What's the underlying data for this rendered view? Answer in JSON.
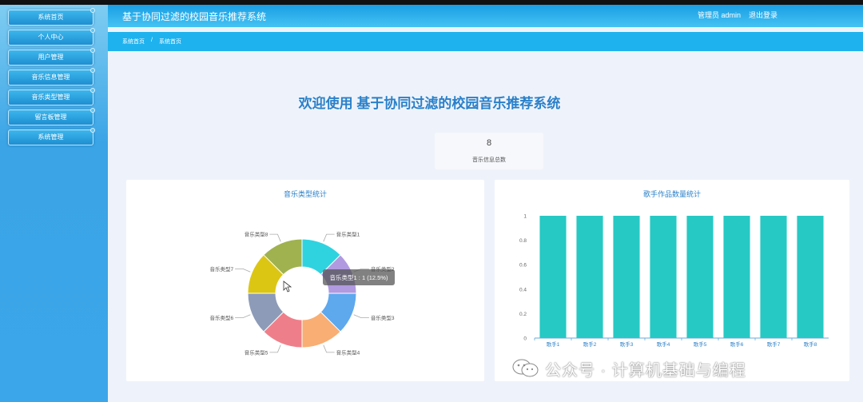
{
  "app": {
    "title": "基于协同过滤的校园音乐推荐系统"
  },
  "header": {
    "user_label": "管理员 admin",
    "logout_label": "退出登录"
  },
  "sidebar": {
    "items": [
      {
        "label": "系统首页"
      },
      {
        "label": "个人中心"
      },
      {
        "label": "用户管理"
      },
      {
        "label": "音乐信息管理"
      },
      {
        "label": "音乐类型管理"
      },
      {
        "label": "留言板管理"
      },
      {
        "label": "系统管理"
      }
    ]
  },
  "breadcrumb": {
    "items": [
      "系统首页",
      "系统首页"
    ],
    "separator": "/"
  },
  "welcome": {
    "text": "欢迎使用 基于协同过滤的校园音乐推荐系统"
  },
  "stat": {
    "value": "8",
    "label": "音乐信息总数"
  },
  "pie_chart": {
    "tooltip": "音乐类型1 : 1 (12.5%)"
  },
  "chart_data": [
    {
      "type": "pie",
      "title": "音乐类型统计",
      "categories": [
        "音乐类型1",
        "音乐类型2",
        "音乐类型3",
        "音乐类型4",
        "音乐类型5",
        "音乐类型6",
        "音乐类型7",
        "音乐类型8"
      ],
      "values": [
        1,
        1,
        1,
        1,
        1,
        1,
        1,
        1
      ],
      "colors": [
        "#2fd3e0",
        "#b19ae0",
        "#5ea8ee",
        "#f9ae73",
        "#ee7f8a",
        "#8d9bb8",
        "#dcc614",
        "#9fb24f"
      ],
      "donut": true
    },
    {
      "type": "bar",
      "title": "歌手作品数量统计",
      "categories": [
        "歌手1",
        "歌手2",
        "歌手3",
        "歌手4",
        "歌手5",
        "歌手6",
        "歌手7",
        "歌手8"
      ],
      "values": [
        1,
        1,
        1,
        1,
        1,
        1,
        1,
        1
      ],
      "yticks": [
        "0",
        "0.2",
        "0.4",
        "0.6",
        "0.8",
        "1"
      ],
      "ylim": [
        0,
        1
      ],
      "color": "#26c9c4",
      "grid": false
    }
  ],
  "watermark": {
    "text": "公众号 · 计算机基础与编程"
  },
  "colors": {
    "header": "#1a9ee4",
    "sidebar": "#3aa4e6",
    "accent": "#2a80c9"
  }
}
